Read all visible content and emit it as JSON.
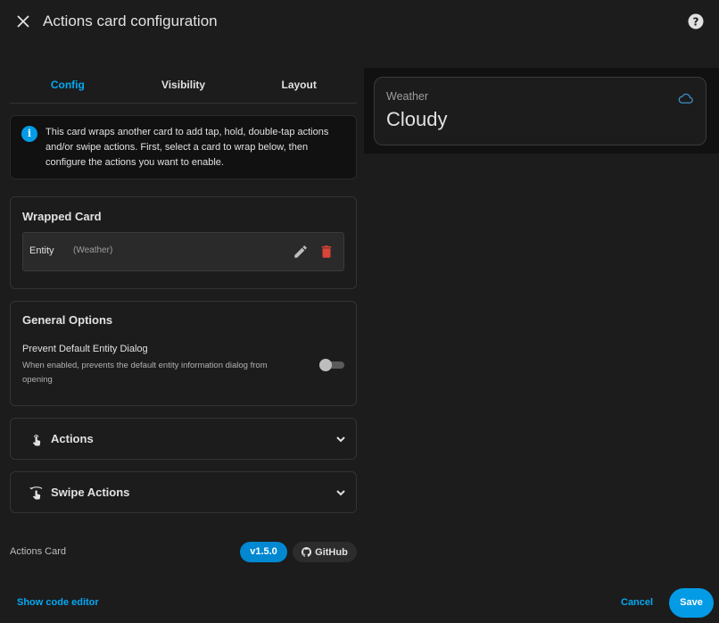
{
  "dialog": {
    "title": "Actions card configuration"
  },
  "tabs": [
    {
      "label": "Config",
      "active": true
    },
    {
      "label": "Visibility",
      "active": false
    },
    {
      "label": "Layout",
      "active": false
    }
  ],
  "info": {
    "icon": "info-icon",
    "text": "This card wraps another card to add tap, hold, double-tap actions and/or swipe actions. First, select a card to wrap below, then configure the actions you want to enable."
  },
  "wrapped_card": {
    "title": "Wrapped Card",
    "entity_label": "Entity",
    "entity_sub": "(Weather)"
  },
  "general_options": {
    "title": "General Options",
    "option_label": "Prevent Default Entity Dialog",
    "option_desc": "When enabled, prevents the default entity information dialog from opening",
    "toggle_on": false
  },
  "expanders": {
    "actions_label": "Actions",
    "swipe_label": "Swipe Actions"
  },
  "footer": {
    "name": "Actions Card",
    "version": "v1.5.0",
    "github": "GitHub",
    "show_code": "Show code editor",
    "cancel": "Cancel",
    "save": "Save"
  },
  "preview": {
    "card_title": "Weather",
    "state": "Cloudy",
    "icon": "cloud-icon"
  },
  "colors": {
    "accent": "#03a9f4",
    "danger": "#db4437",
    "background": "#1c1c1c"
  }
}
